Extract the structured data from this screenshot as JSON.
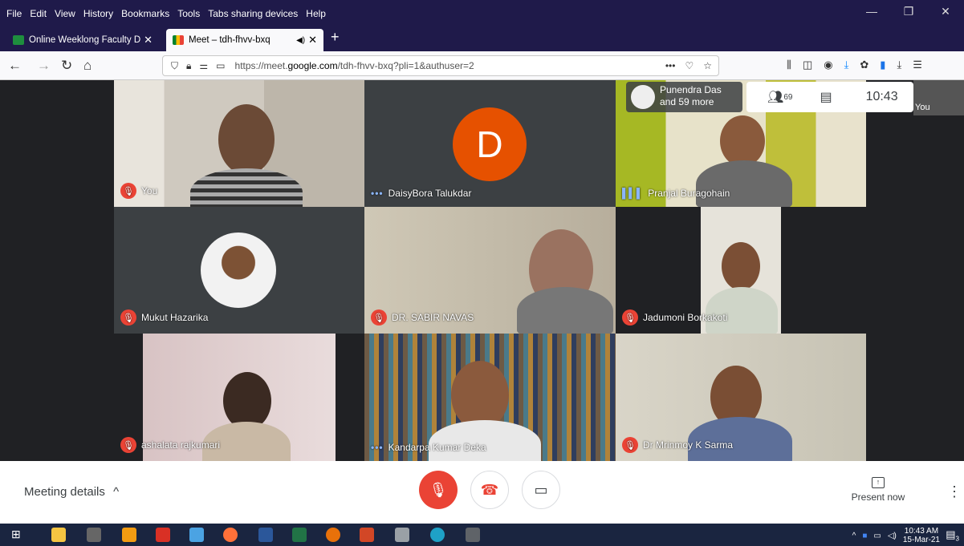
{
  "menubar": {
    "items": [
      "File",
      "Edit",
      "View",
      "History",
      "Bookmarks",
      "Tools",
      "Tabs sharing devices",
      "Help"
    ],
    "window_controls": [
      "—",
      "❐",
      "✕"
    ]
  },
  "tabs": [
    {
      "title": "Online Weeklong Faculty Devel",
      "close": "✕"
    },
    {
      "title": "Meet – tdh-fhvv-bxq",
      "close": "✕",
      "audio": "🔊"
    }
  ],
  "new_tab": "+",
  "urlbar": {
    "url_prefix": "https://meet.",
    "url_domain": "google.com",
    "url_rest": "/tdh-fhvv-bxq?pli=1&authuser=2",
    "more": "•••"
  },
  "participants": [
    {
      "name": "You",
      "status": "muted"
    },
    {
      "name": "DaisyBora Talukdar",
      "status": "dots",
      "avatar_letter": "D"
    },
    {
      "name": "Pranjal Buragohain",
      "status": "speaking"
    },
    {
      "name": "Mukut Hazarika",
      "status": "muted"
    },
    {
      "name": "DR. SABIR NAVAS",
      "status": "muted"
    },
    {
      "name": "Jadumoni Borkakoti",
      "status": "muted"
    },
    {
      "name": "ashalata rajkumari",
      "status": "muted"
    },
    {
      "name": "Kandarpa Kumar Deka",
      "status": "dots"
    },
    {
      "name": "Dr Mrinmoy K Sarma",
      "status": "muted"
    }
  ],
  "infobar": {
    "line1": "Punendra Das",
    "line2": "and 59 more"
  },
  "panel": {
    "people_count": "69",
    "time": "10:43"
  },
  "you_mini": "You",
  "bottom": {
    "meeting_details": "Meeting details",
    "chevron": "^",
    "present_now": "Present now",
    "more": "⋮"
  },
  "taskbar": {
    "time": "10:43 AM",
    "date": "15-Mar-21",
    "notification_count": "3"
  },
  "colors": {
    "mute_red": "#ea4335",
    "meet_bg": "#202124",
    "firefox_chrome": "#1f1a4a"
  }
}
